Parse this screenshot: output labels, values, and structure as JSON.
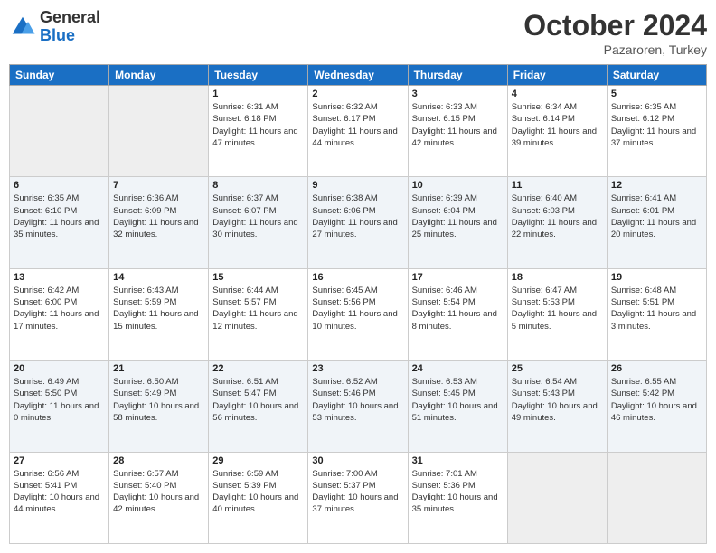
{
  "header": {
    "logo": {
      "general": "General",
      "blue": "Blue"
    },
    "title": "October 2024",
    "location": "Pazaroren, Turkey"
  },
  "weekdays": [
    "Sunday",
    "Monday",
    "Tuesday",
    "Wednesday",
    "Thursday",
    "Friday",
    "Saturday"
  ],
  "weeks": [
    [
      {
        "day": "",
        "sunrise": "",
        "sunset": "",
        "daylight": ""
      },
      {
        "day": "",
        "sunrise": "",
        "sunset": "",
        "daylight": ""
      },
      {
        "day": "1",
        "sunrise": "Sunrise: 6:31 AM",
        "sunset": "Sunset: 6:18 PM",
        "daylight": "Daylight: 11 hours and 47 minutes."
      },
      {
        "day": "2",
        "sunrise": "Sunrise: 6:32 AM",
        "sunset": "Sunset: 6:17 PM",
        "daylight": "Daylight: 11 hours and 44 minutes."
      },
      {
        "day": "3",
        "sunrise": "Sunrise: 6:33 AM",
        "sunset": "Sunset: 6:15 PM",
        "daylight": "Daylight: 11 hours and 42 minutes."
      },
      {
        "day": "4",
        "sunrise": "Sunrise: 6:34 AM",
        "sunset": "Sunset: 6:14 PM",
        "daylight": "Daylight: 11 hours and 39 minutes."
      },
      {
        "day": "5",
        "sunrise": "Sunrise: 6:35 AM",
        "sunset": "Sunset: 6:12 PM",
        "daylight": "Daylight: 11 hours and 37 minutes."
      }
    ],
    [
      {
        "day": "6",
        "sunrise": "Sunrise: 6:35 AM",
        "sunset": "Sunset: 6:10 PM",
        "daylight": "Daylight: 11 hours and 35 minutes."
      },
      {
        "day": "7",
        "sunrise": "Sunrise: 6:36 AM",
        "sunset": "Sunset: 6:09 PM",
        "daylight": "Daylight: 11 hours and 32 minutes."
      },
      {
        "day": "8",
        "sunrise": "Sunrise: 6:37 AM",
        "sunset": "Sunset: 6:07 PM",
        "daylight": "Daylight: 11 hours and 30 minutes."
      },
      {
        "day": "9",
        "sunrise": "Sunrise: 6:38 AM",
        "sunset": "Sunset: 6:06 PM",
        "daylight": "Daylight: 11 hours and 27 minutes."
      },
      {
        "day": "10",
        "sunrise": "Sunrise: 6:39 AM",
        "sunset": "Sunset: 6:04 PM",
        "daylight": "Daylight: 11 hours and 25 minutes."
      },
      {
        "day": "11",
        "sunrise": "Sunrise: 6:40 AM",
        "sunset": "Sunset: 6:03 PM",
        "daylight": "Daylight: 11 hours and 22 minutes."
      },
      {
        "day": "12",
        "sunrise": "Sunrise: 6:41 AM",
        "sunset": "Sunset: 6:01 PM",
        "daylight": "Daylight: 11 hours and 20 minutes."
      }
    ],
    [
      {
        "day": "13",
        "sunrise": "Sunrise: 6:42 AM",
        "sunset": "Sunset: 6:00 PM",
        "daylight": "Daylight: 11 hours and 17 minutes."
      },
      {
        "day": "14",
        "sunrise": "Sunrise: 6:43 AM",
        "sunset": "Sunset: 5:59 PM",
        "daylight": "Daylight: 11 hours and 15 minutes."
      },
      {
        "day": "15",
        "sunrise": "Sunrise: 6:44 AM",
        "sunset": "Sunset: 5:57 PM",
        "daylight": "Daylight: 11 hours and 12 minutes."
      },
      {
        "day": "16",
        "sunrise": "Sunrise: 6:45 AM",
        "sunset": "Sunset: 5:56 PM",
        "daylight": "Daylight: 11 hours and 10 minutes."
      },
      {
        "day": "17",
        "sunrise": "Sunrise: 6:46 AM",
        "sunset": "Sunset: 5:54 PM",
        "daylight": "Daylight: 11 hours and 8 minutes."
      },
      {
        "day": "18",
        "sunrise": "Sunrise: 6:47 AM",
        "sunset": "Sunset: 5:53 PM",
        "daylight": "Daylight: 11 hours and 5 minutes."
      },
      {
        "day": "19",
        "sunrise": "Sunrise: 6:48 AM",
        "sunset": "Sunset: 5:51 PM",
        "daylight": "Daylight: 11 hours and 3 minutes."
      }
    ],
    [
      {
        "day": "20",
        "sunrise": "Sunrise: 6:49 AM",
        "sunset": "Sunset: 5:50 PM",
        "daylight": "Daylight: 11 hours and 0 minutes."
      },
      {
        "day": "21",
        "sunrise": "Sunrise: 6:50 AM",
        "sunset": "Sunset: 5:49 PM",
        "daylight": "Daylight: 10 hours and 58 minutes."
      },
      {
        "day": "22",
        "sunrise": "Sunrise: 6:51 AM",
        "sunset": "Sunset: 5:47 PM",
        "daylight": "Daylight: 10 hours and 56 minutes."
      },
      {
        "day": "23",
        "sunrise": "Sunrise: 6:52 AM",
        "sunset": "Sunset: 5:46 PM",
        "daylight": "Daylight: 10 hours and 53 minutes."
      },
      {
        "day": "24",
        "sunrise": "Sunrise: 6:53 AM",
        "sunset": "Sunset: 5:45 PM",
        "daylight": "Daylight: 10 hours and 51 minutes."
      },
      {
        "day": "25",
        "sunrise": "Sunrise: 6:54 AM",
        "sunset": "Sunset: 5:43 PM",
        "daylight": "Daylight: 10 hours and 49 minutes."
      },
      {
        "day": "26",
        "sunrise": "Sunrise: 6:55 AM",
        "sunset": "Sunset: 5:42 PM",
        "daylight": "Daylight: 10 hours and 46 minutes."
      }
    ],
    [
      {
        "day": "27",
        "sunrise": "Sunrise: 6:56 AM",
        "sunset": "Sunset: 5:41 PM",
        "daylight": "Daylight: 10 hours and 44 minutes."
      },
      {
        "day": "28",
        "sunrise": "Sunrise: 6:57 AM",
        "sunset": "Sunset: 5:40 PM",
        "daylight": "Daylight: 10 hours and 42 minutes."
      },
      {
        "day": "29",
        "sunrise": "Sunrise: 6:59 AM",
        "sunset": "Sunset: 5:39 PM",
        "daylight": "Daylight: 10 hours and 40 minutes."
      },
      {
        "day": "30",
        "sunrise": "Sunrise: 7:00 AM",
        "sunset": "Sunset: 5:37 PM",
        "daylight": "Daylight: 10 hours and 37 minutes."
      },
      {
        "day": "31",
        "sunrise": "Sunrise: 7:01 AM",
        "sunset": "Sunset: 5:36 PM",
        "daylight": "Daylight: 10 hours and 35 minutes."
      },
      {
        "day": "",
        "sunrise": "",
        "sunset": "",
        "daylight": ""
      },
      {
        "day": "",
        "sunrise": "",
        "sunset": "",
        "daylight": ""
      }
    ]
  ]
}
